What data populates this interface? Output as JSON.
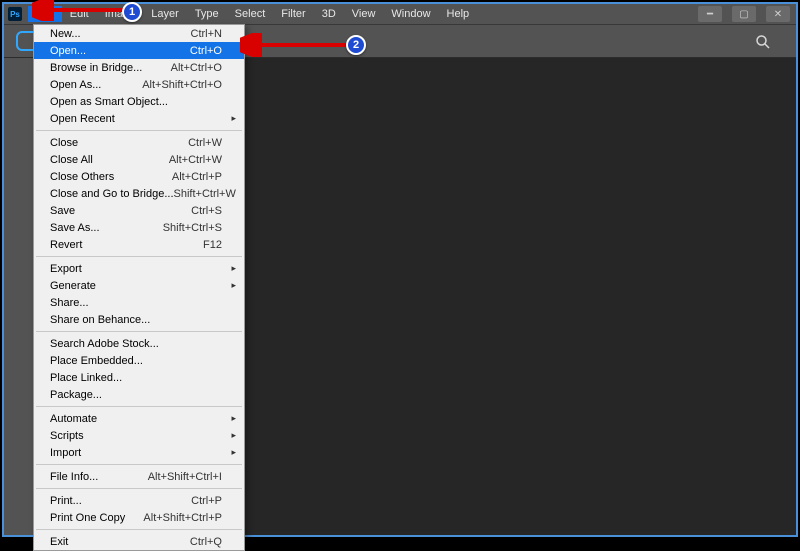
{
  "menubar": {
    "items": [
      "File",
      "Edit",
      "Image",
      "Layer",
      "Type",
      "Select",
      "Filter",
      "3D",
      "View",
      "Window",
      "Help"
    ],
    "active_index": 0
  },
  "dropdown": {
    "selected_index": 1,
    "groups": [
      [
        {
          "label": "New...",
          "shortcut": "Ctrl+N"
        },
        {
          "label": "Open...",
          "shortcut": "Ctrl+O"
        },
        {
          "label": "Browse in Bridge...",
          "shortcut": "Alt+Ctrl+O"
        },
        {
          "label": "Open As...",
          "shortcut": "Alt+Shift+Ctrl+O"
        },
        {
          "label": "Open as Smart Object..."
        },
        {
          "label": "Open Recent",
          "sub": true
        }
      ],
      [
        {
          "label": "Close",
          "shortcut": "Ctrl+W"
        },
        {
          "label": "Close All",
          "shortcut": "Alt+Ctrl+W"
        },
        {
          "label": "Close Others",
          "shortcut": "Alt+Ctrl+P"
        },
        {
          "label": "Close and Go to Bridge...",
          "shortcut": "Shift+Ctrl+W"
        },
        {
          "label": "Save",
          "shortcut": "Ctrl+S"
        },
        {
          "label": "Save As...",
          "shortcut": "Shift+Ctrl+S"
        },
        {
          "label": "Revert",
          "shortcut": "F12"
        }
      ],
      [
        {
          "label": "Export",
          "sub": true
        },
        {
          "label": "Generate",
          "sub": true
        },
        {
          "label": "Share..."
        },
        {
          "label": "Share on Behance..."
        }
      ],
      [
        {
          "label": "Search Adobe Stock..."
        },
        {
          "label": "Place Embedded..."
        },
        {
          "label": "Place Linked..."
        },
        {
          "label": "Package..."
        }
      ],
      [
        {
          "label": "Automate",
          "sub": true
        },
        {
          "label": "Scripts",
          "sub": true
        },
        {
          "label": "Import",
          "sub": true
        }
      ],
      [
        {
          "label": "File Info...",
          "shortcut": "Alt+Shift+Ctrl+I"
        }
      ],
      [
        {
          "label": "Print...",
          "shortcut": "Ctrl+P"
        },
        {
          "label": "Print One Copy",
          "shortcut": "Alt+Shift+Ctrl+P"
        }
      ],
      [
        {
          "label": "Exit",
          "shortcut": "Ctrl+Q"
        }
      ]
    ]
  },
  "annotations": {
    "callout1": "1",
    "callout2": "2"
  },
  "app": {
    "badge": "Ps"
  }
}
